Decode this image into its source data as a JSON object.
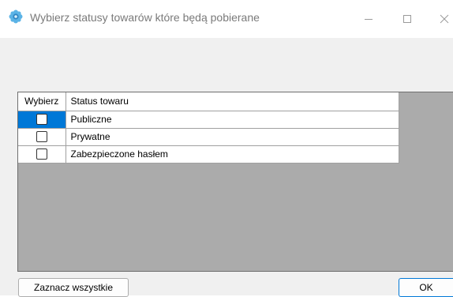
{
  "window": {
    "title": "Wybierz statusy towarów które będą pobierane",
    "icon": "gear-flower-icon",
    "controls": {
      "minimize": "—",
      "maximize": "☐",
      "close": "✕"
    }
  },
  "grid": {
    "columns": [
      "Wybierz",
      "Status towaru"
    ],
    "rows": [
      {
        "checked": false,
        "status": "Publiczne",
        "selected": true
      },
      {
        "checked": false,
        "status": "Prywatne",
        "selected": false
      },
      {
        "checked": false,
        "status": "Zabezpieczone hasłem",
        "selected": false
      }
    ]
  },
  "buttons": {
    "select_all": "Zaznacz wszystkie",
    "ok": "OK"
  },
  "colors": {
    "selection": "#0078d7",
    "grid_background": "#ababab",
    "window_background": "#f0f0f0"
  }
}
